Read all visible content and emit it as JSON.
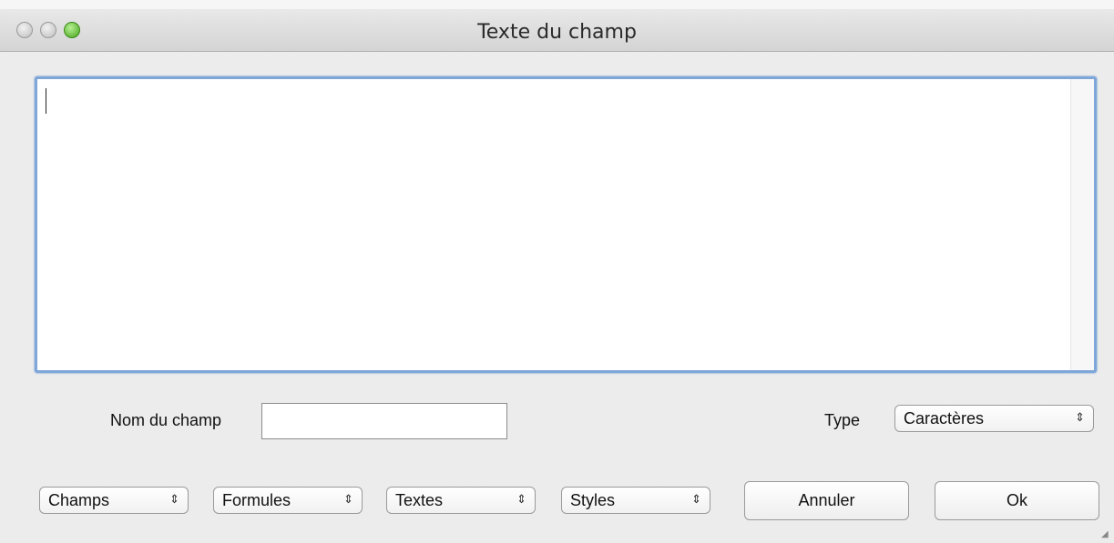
{
  "window": {
    "title": "Texte du champ"
  },
  "form": {
    "text_area_value": "",
    "field_name_label": "Nom du champ",
    "field_name_value": "",
    "type_label": "Type",
    "type_selected": "Caractères"
  },
  "toolbar": {
    "champs_label": "Champs",
    "formules_label": "Formules",
    "textes_label": "Textes",
    "styles_label": "Styles",
    "cancel_label": "Annuler",
    "ok_label": "Ok"
  },
  "icons": {
    "popup_arrows": "⇕"
  }
}
